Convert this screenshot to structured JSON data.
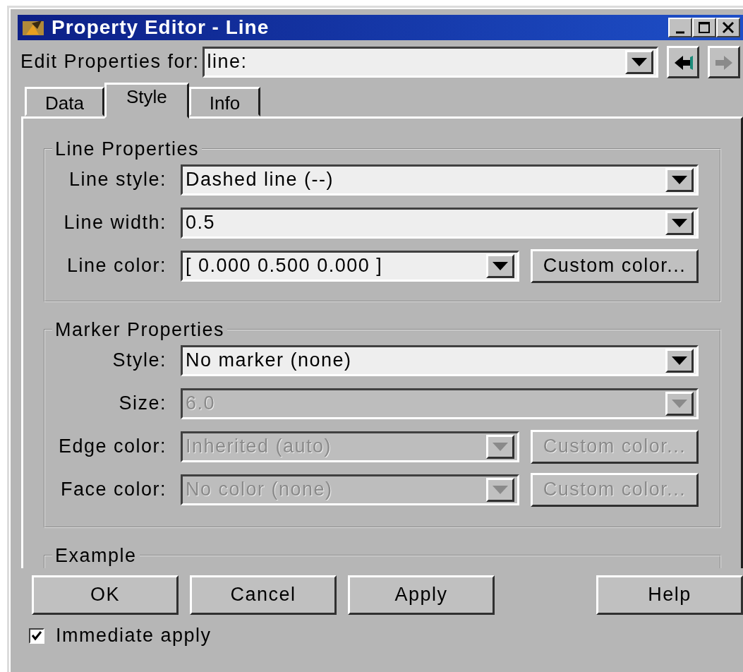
{
  "window": {
    "title": "Property Editor - Line"
  },
  "edit_for": {
    "label": "Edit Properties for:",
    "value": "line:"
  },
  "nav_buttons": [
    {
      "kind": "back",
      "disabled": false
    },
    {
      "kind": "forward",
      "disabled": true
    }
  ],
  "tabs": [
    {
      "label": "Data",
      "selected": false
    },
    {
      "label": "Style",
      "selected": true
    },
    {
      "label": "Info",
      "selected": false
    }
  ],
  "groups": [
    {
      "title": "Line Properties",
      "rows": [
        {
          "label": "Line style:",
          "value": "Dashed line (--)",
          "disabled": false
        },
        {
          "label": "Line width:",
          "value": "0.5",
          "disabled": false
        },
        {
          "label": "Line color:",
          "value": "[ 0.000 0.500 0.000 ]",
          "disabled": false,
          "custom_button": {
            "label": "Custom color...",
            "disabled": false
          }
        }
      ]
    },
    {
      "title": "Marker Properties",
      "rows": [
        {
          "label": "Style:",
          "value": "No marker (none)",
          "disabled": false
        },
        {
          "label": "Size:",
          "value": "6.0",
          "disabled": true
        },
        {
          "label": "Edge color:",
          "value": "Inherited (auto)",
          "disabled": true,
          "custom_button": {
            "label": "Custom color...",
            "disabled": true
          }
        },
        {
          "label": "Face color:",
          "value": "No color (none)",
          "disabled": true,
          "custom_button": {
            "label": "Custom color...",
            "disabled": true
          }
        }
      ]
    },
    {
      "title": "Example"
    }
  ],
  "buttons": [
    {
      "label": "OK"
    },
    {
      "label": "Cancel"
    },
    {
      "label": "Apply"
    },
    {
      "label": "Help"
    }
  ],
  "immediate_apply": {
    "label": "Immediate apply",
    "checked": true
  }
}
